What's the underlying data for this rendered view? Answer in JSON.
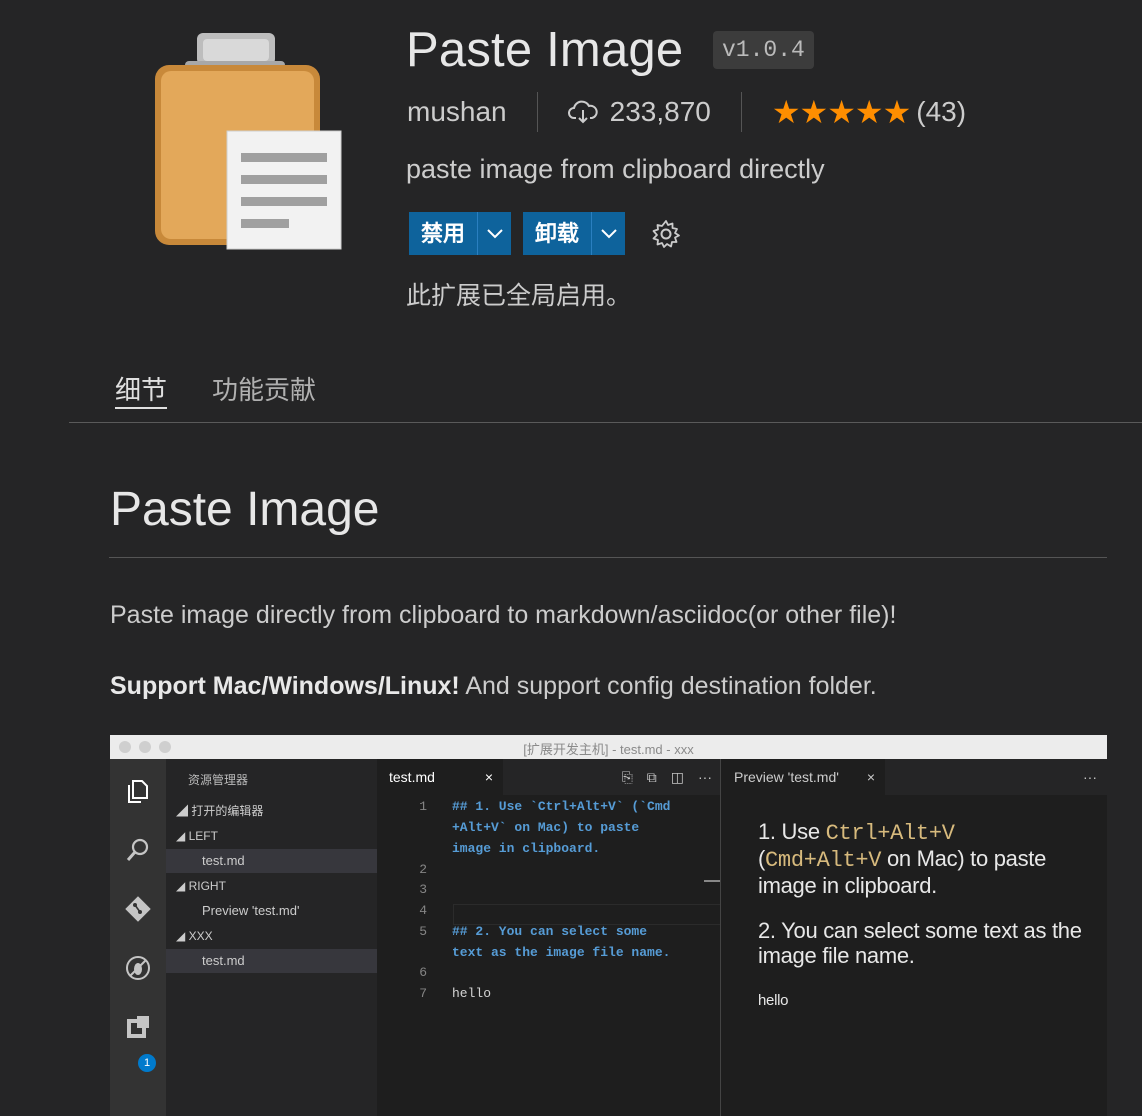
{
  "extension": {
    "title": "Paste Image",
    "version": "v1.0.4",
    "publisher": "mushan",
    "installs": "233,870",
    "rating_stars": "★★★★★",
    "rating_count": "(43)",
    "description": "paste image from clipboard directly",
    "disable_label": "禁用",
    "uninstall_label": "卸载",
    "status": "此扩展已全局启用。"
  },
  "tabs": [
    "细节",
    "功能贡献"
  ],
  "readme": {
    "heading": "Paste Image",
    "para1": "Paste image directly from clipboard to markdown/asciidoc(or other file)!",
    "para2_bold": "Support Mac/Windows/Linux!",
    "para2_rest": " And support config destination folder."
  },
  "screenshot": {
    "window_title": "[扩展开发主机] - test.md - xxx",
    "explorer_title": "资源管理器",
    "explorer": {
      "open_editors": "打开的编辑器",
      "left": "LEFT",
      "left_file": "test.md",
      "right": "RIGHT",
      "right_file": "Preview 'test.md'",
      "xxx": "XXX",
      "xxx_file": "test.md"
    },
    "editor_tab": "test.md",
    "editor_tab_close": "×",
    "editor_more": "···",
    "code_lines": [
      {
        "n": "1",
        "text": "## 1. Use `Ctrl+Alt+V` (`Cmd"
      },
      {
        "n": "",
        "text": "+Alt+V` on Mac) to paste"
      },
      {
        "n": "",
        "text": "image in clipboard."
      },
      {
        "n": "2",
        "text": ""
      },
      {
        "n": "3",
        "text": ""
      },
      {
        "n": "4",
        "text": ""
      },
      {
        "n": "5",
        "text": "## 2. You can select some"
      },
      {
        "n": "",
        "text": "text as the image file name."
      },
      {
        "n": "6",
        "text": ""
      },
      {
        "n": "7",
        "text": "hello"
      }
    ],
    "preview_tab": "Preview 'test.md'",
    "preview_tab_close": "×",
    "preview_more": "···",
    "preview": {
      "item1_num": "1. Use ",
      "item1_code1": "Ctrl+Alt+V",
      "item1_paren_open": "(",
      "item1_code2": "Cmd+Alt+V",
      "item1_rest": " on Mac) to paste image in clipboard.",
      "item2": "2. You can select some text as the image file name.",
      "hello": "hello"
    },
    "badge": "1"
  },
  "colors": {
    "background": "#252526",
    "button": "#0e639c",
    "stars": "#ff8e00",
    "code_heading": "#569cd6"
  },
  "icons": [
    "clipboard-icon",
    "download-cloud-icon",
    "chevron-down-icon",
    "gear-icon",
    "files-icon",
    "search-icon",
    "git-icon",
    "debug-icon",
    "extensions-icon"
  ]
}
